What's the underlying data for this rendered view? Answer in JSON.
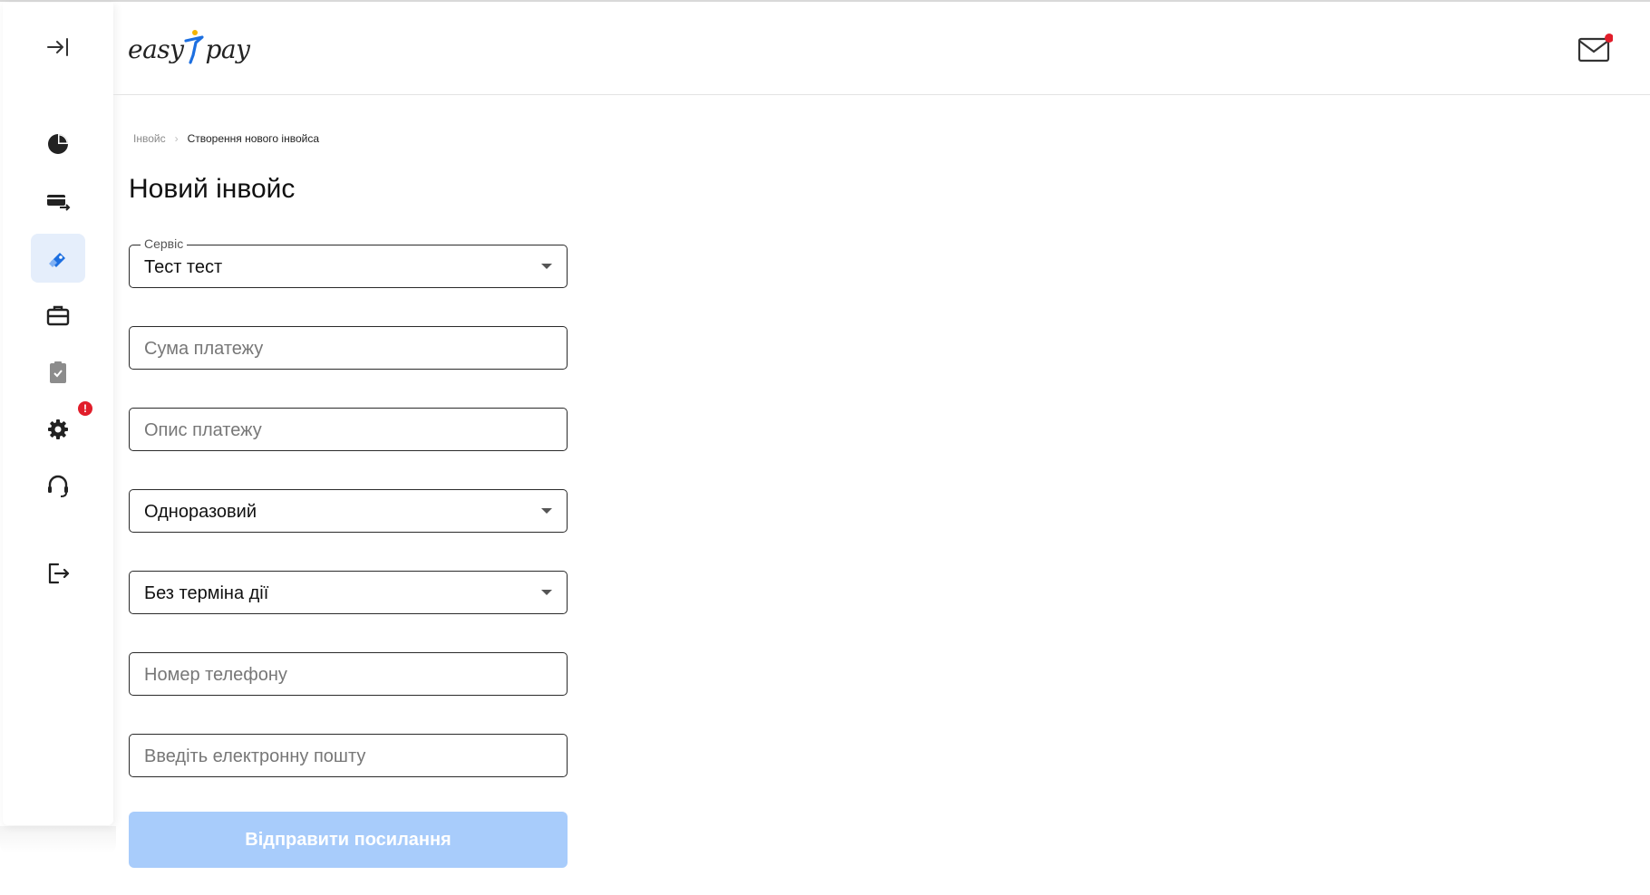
{
  "header": {
    "logo_left": "easy",
    "logo_right": "pay",
    "colors": {
      "logo_figure_blue": "#1d6fe0",
      "logo_figure_yellow": "#f5b400",
      "notification_dot": "#e11d2a"
    }
  },
  "sidebar": {
    "items": [
      {
        "icon": "collapse-sidebar-icon"
      },
      {
        "icon": "pie-chart-icon"
      },
      {
        "icon": "transfers-icon"
      },
      {
        "icon": "invoice-icon",
        "active": true
      },
      {
        "icon": "briefcase-icon"
      },
      {
        "icon": "clipboard-check-icon"
      },
      {
        "icon": "gear-icon",
        "badge": "!"
      },
      {
        "icon": "headset-icon"
      },
      {
        "icon": "logout-icon"
      }
    ],
    "settings_badge": "!",
    "colors": {
      "active_bg": "#e5eefb",
      "active_icon": "#1d6fe0"
    }
  },
  "breadcrumb": {
    "parent": "Інвойс",
    "separator": "›",
    "current": "Створення нового інвойса"
  },
  "page": {
    "title": "Новий інвойс"
  },
  "form": {
    "service": {
      "label": "Сервіс",
      "value": "Тест тест"
    },
    "amount": {
      "placeholder": "Сума платежу"
    },
    "description": {
      "placeholder": "Опис платежу"
    },
    "type": {
      "value": "Одноразовий"
    },
    "expiry": {
      "value": "Без терміна дії"
    },
    "phone": {
      "placeholder": "Номер телефону"
    },
    "email": {
      "placeholder": "Введіть електронну пошту"
    },
    "submit_label": "Відправити посилання",
    "submit_enabled": false,
    "colors": {
      "submit_disabled_bg": "#a8ccfb"
    }
  }
}
